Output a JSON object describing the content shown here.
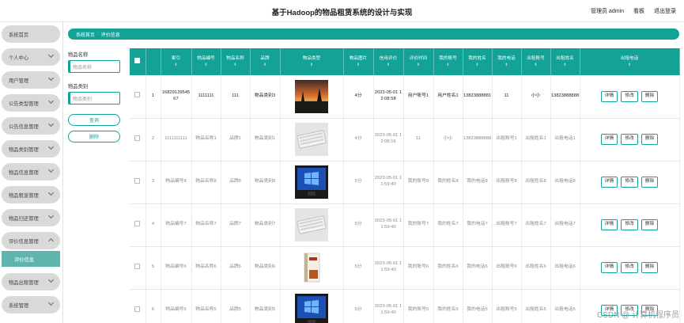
{
  "header": {
    "title": "基于Hadoop的物品租赁系统的设计与实现",
    "admin": "管理员 admin",
    "nav_kanban": "看板",
    "nav_logout": "退出登录"
  },
  "sidebar": {
    "items": [
      {
        "label": "系统首页",
        "chevron": false
      },
      {
        "label": "个人中心",
        "chevron": true
      },
      {
        "label": "用户管理",
        "chevron": true
      },
      {
        "label": "公告类型管理",
        "chevron": true
      },
      {
        "label": "公告信息管理",
        "chevron": true
      },
      {
        "label": "物品类别管理",
        "chevron": true
      },
      {
        "label": "物品信息管理",
        "chevron": true
      },
      {
        "label": "物品租赁管理",
        "chevron": true
      },
      {
        "label": "物品归还管理",
        "chevron": true
      },
      {
        "label": "评价信息管理",
        "chevron": true,
        "open": true
      },
      {
        "label": "物品出租管理",
        "chevron": true
      },
      {
        "label": "系统管理",
        "chevron": true
      }
    ],
    "sub_active": "评价信息"
  },
  "breadcrumb": {
    "home": "系统首页",
    "sep": ":",
    "current": "评价信息"
  },
  "search": {
    "name_label": "物品名称",
    "name_placeholder": "物品名称",
    "category_label": "物品类别",
    "category_placeholder": "物品类别",
    "query_button": "查询",
    "delete_button": "删除"
  },
  "table": {
    "columns": [
      "索引",
      "物品编号",
      "物品名称",
      "品牌",
      "物品类型",
      "物品图片",
      "信用评价",
      "评价时间",
      "我的账号",
      "我的姓名",
      "我的电话",
      "出租账号",
      "出租姓名",
      "出租电话",
      "操作"
    ],
    "sort_marker": "⇕",
    "op_labels": [
      "详情",
      "修改",
      "删除"
    ],
    "rows": [
      {
        "index": "1",
        "code": "1682913954567",
        "name": "1111111",
        "brand": "111",
        "type": "物品类别3",
        "image": "sunset",
        "rating": "4分",
        "time": "2023-05-01 12:08:58",
        "my_account": "用户账号1",
        "my_name": "用户姓名1",
        "my_phone": "13823888881",
        "rent_account": "11",
        "rent_name": "小小",
        "rent_phone": "13823888888"
      },
      {
        "index": "2",
        "code": "1111111111",
        "name": "物品名称1",
        "brand": "品牌1",
        "type": "物品类别1",
        "image": "keyboard",
        "rating": "4分",
        "time": "2023-05-01 12:08:16",
        "my_account": "11",
        "my_name": "小小",
        "my_phone": "13823888888",
        "rent_account": "出租账号1",
        "rent_name": "出租姓名1",
        "rent_phone": "出租电话1"
      },
      {
        "index": "3",
        "code": "物品编号8",
        "name": "物品名称8",
        "brand": "品牌8",
        "type": "物品类别8",
        "image": "monitor",
        "rating": "5分",
        "time": "2023-05-01 11:59:40",
        "my_account": "我的账号8",
        "my_name": "我的姓名8",
        "my_phone": "我的电话8",
        "rent_account": "出租账号8",
        "rent_name": "出租姓名8",
        "rent_phone": "出租电话8"
      },
      {
        "index": "4",
        "code": "物品编号7",
        "name": "物品名称7",
        "brand": "品牌7",
        "type": "物品类别7",
        "image": "keyboard",
        "rating": "5分",
        "time": "2023-05-01 11:59:40",
        "my_account": "我的账号7",
        "my_name": "我的姓名7",
        "my_phone": "我的电话7",
        "rent_account": "出租账号7",
        "rent_name": "出租姓名7",
        "rent_phone": "出租电话7"
      },
      {
        "index": "5",
        "code": "物品编号6",
        "name": "物品名称6",
        "brand": "品牌6",
        "type": "物品类别6",
        "image": "book",
        "rating": "5分",
        "time": "2023-05-01 11:59:40",
        "my_account": "我的账号6",
        "my_name": "我的姓名6",
        "my_phone": "我的电话6",
        "rent_account": "出租账号6",
        "rent_name": "出租姓名6",
        "rent_phone": "出租电话6"
      },
      {
        "index": "6",
        "code": "物品编号5",
        "name": "物品名称5",
        "brand": "品牌5",
        "type": "物品类别5",
        "image": "monitor",
        "rating": "5分",
        "time": "2023-05-01 11:59:40",
        "my_account": "我的账号5",
        "my_name": "我的姓名5",
        "my_phone": "我的电话5",
        "rent_account": "出租账号5",
        "rent_name": "出租姓名5",
        "rent_phone": "出租电话5"
      }
    ]
  },
  "watermark": "CSDN @ 计算机程序员"
}
